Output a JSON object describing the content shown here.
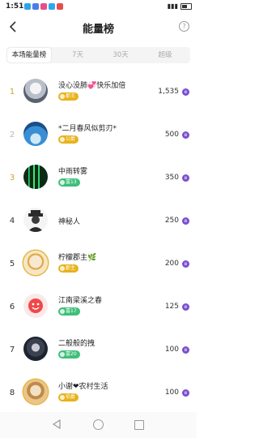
{
  "status_bar": {
    "time": "1:51",
    "signal": "▮▮▮",
    "notifications": [
      {
        "icon": "app-notification-icon",
        "color": "#2ba5e8"
      },
      {
        "icon": "app-notification-icon",
        "color": "#4c7de6"
      },
      {
        "icon": "app-notification-icon",
        "color": "#e84c8b"
      },
      {
        "icon": "app-notification-icon",
        "color": "#2aa8f0"
      },
      {
        "icon": "app-notification-icon",
        "color": "#e84c4c"
      }
    ]
  },
  "header": {
    "title": "能量榜",
    "help_label": "?"
  },
  "tabs": [
    {
      "label": "本场能量榜",
      "active": true
    },
    {
      "label": "7天",
      "active": false
    },
    {
      "label": "30天",
      "active": false
    },
    {
      "label": "超级",
      "active": false
    }
  ],
  "coin_label": "e",
  "rows": [
    {
      "rank": "1",
      "name": "没心没肺💞快乐加倍",
      "badge": "郡王",
      "badge_color": "#e8b21a",
      "score": "1,535",
      "avatar_color": "#dfe3ea"
    },
    {
      "rank": "2",
      "name": "*二月春风似剪刃*",
      "badge": "公爵",
      "badge_color": "#e8b21a",
      "score": "500",
      "avatar_color": "#3a8fd4"
    },
    {
      "rank": "3",
      "name": "中雨转雾",
      "badge": "富13",
      "badge_color": "#3fbf7a",
      "score": "350",
      "avatar_color": "#0d2a17"
    },
    {
      "rank": "4",
      "name": "神秘人",
      "badge": "",
      "badge_color": "",
      "score": "250",
      "avatar_color": "#3b3b3b"
    },
    {
      "rank": "5",
      "name": "柠檬郡主🌿",
      "badge": "郡主",
      "badge_color": "#e8b21a",
      "score": "200",
      "avatar_color": "#f5e6c4"
    },
    {
      "rank": "6",
      "name": "江南梁溪之春",
      "badge": "富17",
      "badge_color": "#3fbf7a",
      "score": "125",
      "avatar_color": "#f04848"
    },
    {
      "rank": "7",
      "name": "二般般的拽",
      "badge": "富20",
      "badge_color": "#3fbf7a",
      "score": "100",
      "avatar_color": "#1d2430"
    },
    {
      "rank": "8",
      "name": "小谢❤农村生活",
      "badge": "伯爵",
      "badge_color": "#e8b21a",
      "score": "100",
      "avatar_color": "#e9c58a"
    }
  ]
}
